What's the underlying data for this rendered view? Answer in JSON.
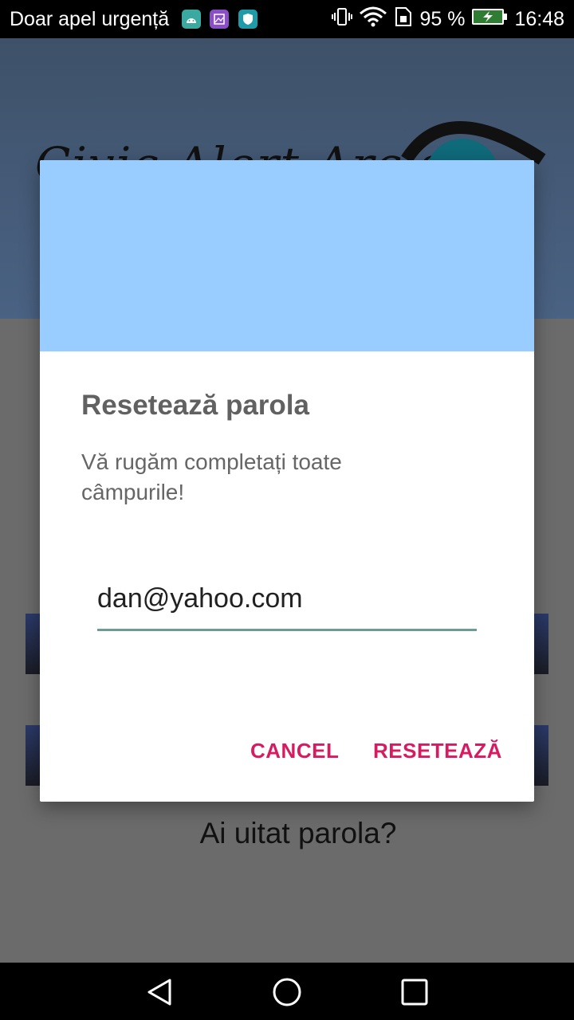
{
  "status_bar": {
    "carrier_text": "Doar apel urgență",
    "notification_icons": [
      "android-icon",
      "gallery-icon",
      "shield-app-icon"
    ],
    "battery_percent": "95 %",
    "time": "16:48",
    "system_icons": [
      "vibrate-icon",
      "wifi-icon",
      "sim-icon",
      "battery-charging-icon"
    ]
  },
  "app": {
    "logo_text": "Civic Alert Arcis",
    "forgot_password": "Ai uitat parola?"
  },
  "dialog": {
    "banner_color": "#99ccff",
    "title": "Resetează parola",
    "message": "Vă rugăm completați toate câmpurile!",
    "email_value": "dan@yahoo.com",
    "cancel_label": "CANCEL",
    "reset_label": "RESETEAZĂ",
    "accent_color": "#d81b60"
  },
  "nav_bar": {
    "buttons": [
      "back-icon",
      "home-icon",
      "recents-icon"
    ]
  }
}
